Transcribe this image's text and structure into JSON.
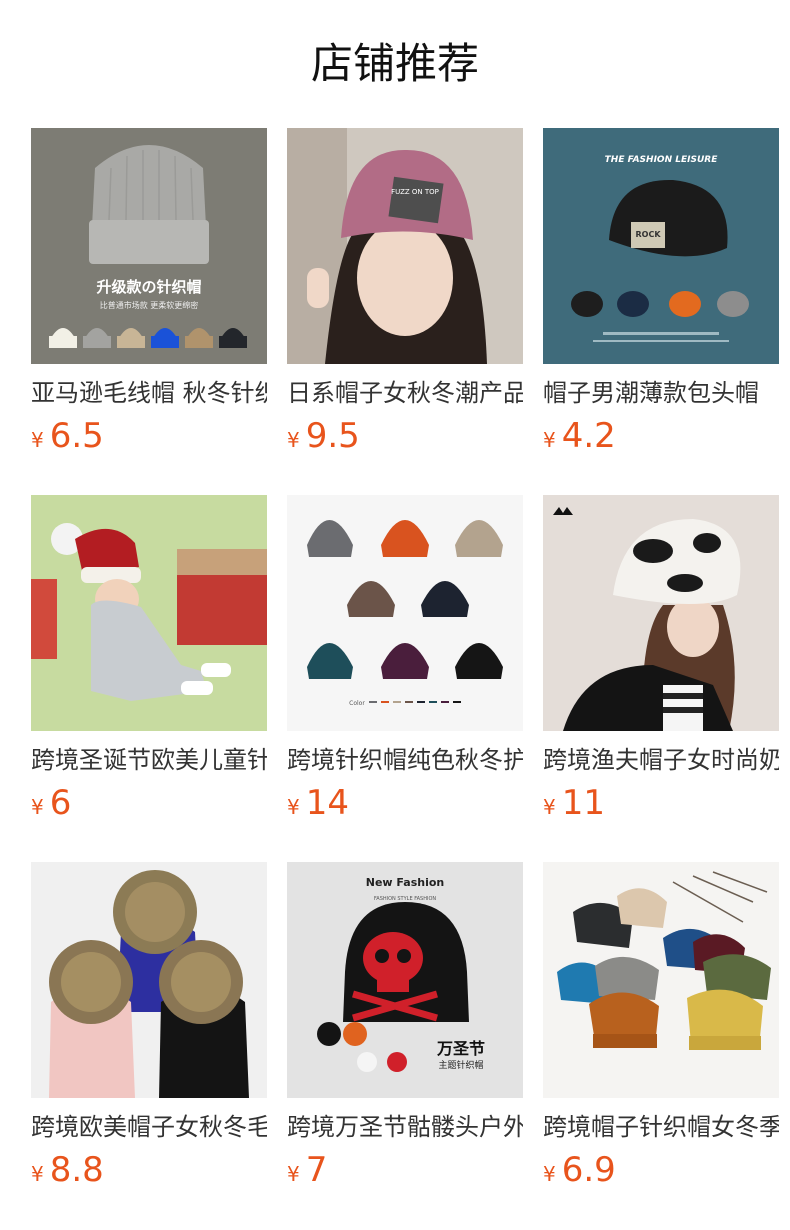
{
  "page_title": "店铺推荐",
  "accent_color": "#e8541c",
  "currency_symbol": "¥",
  "products": [
    {
      "name": "亚马逊毛线帽 秋冬针织帽",
      "price": "6.5",
      "image_text": {
        "headline": "升级款の针织帽",
        "sub": "比普通市场款 更柔软更绵密"
      }
    },
    {
      "name": "日系帽子女秋冬潮产品",
      "price": "9.5",
      "image_text": {
        "label": "FUZZ ON TOP"
      }
    },
    {
      "name": "帽子男潮薄款包头帽",
      "price": "4.2",
      "image_text": {
        "headline": "THE FASHION LEISURE",
        "label": "ROCK"
      }
    },
    {
      "name": "跨境圣诞节欧美儿童针织帽",
      "price": "6",
      "image_text": {}
    },
    {
      "name": "跨境针织帽纯色秋冬护耳帽",
      "price": "14",
      "image_text": {
        "label": "Color"
      }
    },
    {
      "name": "跨境渔夫帽子女时尚奶牛纹",
      "price": "11",
      "image_text": {}
    },
    {
      "name": "跨境欧美帽子女秋冬毛球帽",
      "price": "8.8",
      "image_text": {}
    },
    {
      "name": "跨境万圣节骷髅头户外帽",
      "price": "7",
      "image_text": {
        "headline": "New Fashion",
        "sub": "FASHION STYLE FASHION",
        "label": "万圣节",
        "label2": "主题针织帽"
      }
    },
    {
      "name": "跨境帽子针织帽女冬季",
      "price": "6.9",
      "image_text": {}
    }
  ]
}
